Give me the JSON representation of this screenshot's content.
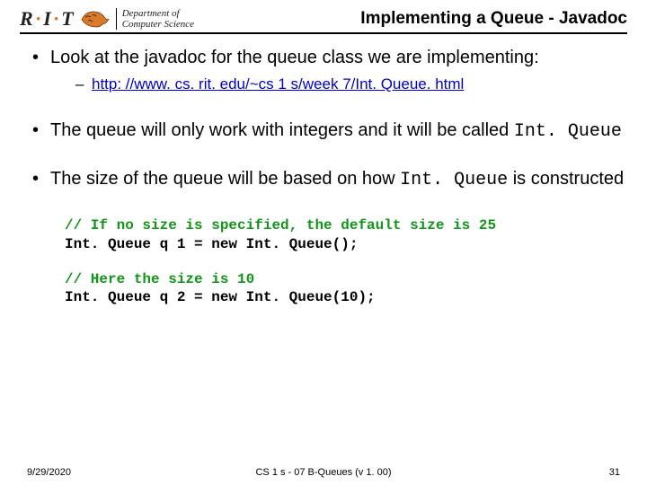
{
  "header": {
    "logo_text_a": "R",
    "logo_text_b": "I",
    "logo_text_c": "T",
    "dept_line1": "Department of",
    "dept_line2": "Computer Science"
  },
  "title": "Implementing a Queue - Javadoc",
  "bullets": {
    "b1_pre": "Look at  the javadoc for the queue class we are implementing:",
    "b1_link": "http: //www. cs. rit. edu/~cs 1 s/week 7/Int. Queue. html",
    "b2_a": "The queue will only work with integers and it will be called ",
    "b2_b": "Int. Queue",
    "b3_a": "The size of the queue will be based on how ",
    "b3_b": "Int. Queue",
    "b3_c": " is constructed"
  },
  "code": {
    "c1": "// If no size is specified, the default size is 25",
    "l1": "Int. Queue q 1 = new Int. Queue();",
    "c2": "// Here the size is 10",
    "l2": "Int. Queue q 2 = new Int. Queue(10);"
  },
  "footer": {
    "date": "9/29/2020",
    "center": "CS 1 s - 07 B-Queues (v 1. 00)",
    "page": "31"
  }
}
